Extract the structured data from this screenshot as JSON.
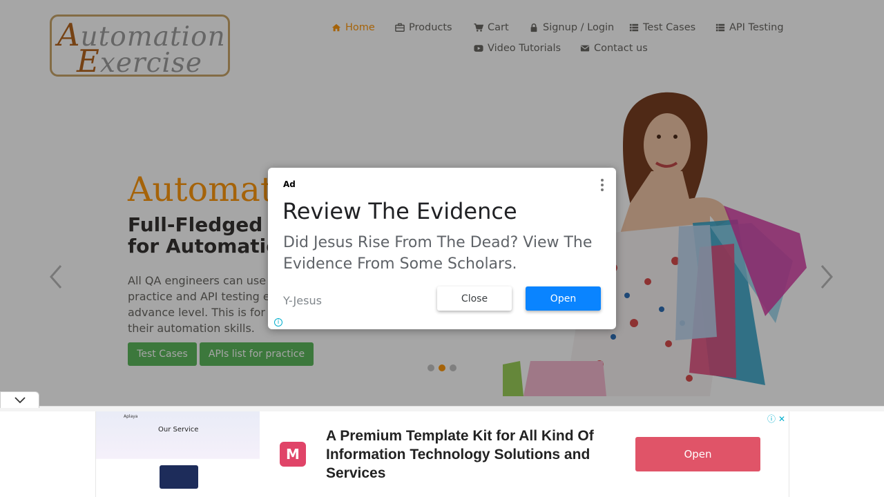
{
  "logo": {
    "line1_cap": "A",
    "line1_rest": "utomation",
    "line2_cap": "E",
    "line2_rest": "xercise"
  },
  "nav": {
    "home": "Home",
    "products": "Products",
    "cart": "Cart",
    "signup": "Signup / Login",
    "test_cases": "Test Cases",
    "api_testing": "API Testing",
    "video": "Video Tutorials",
    "contact": "Contact us"
  },
  "hero": {
    "title": "Automat",
    "subtitle_l1": "Full-Fledged",
    "subtitle_l2": "for Automatic",
    "desc_l1": "All QA engineers can use",
    "desc_l2": "practice and API testing e",
    "desc_l3": "advance level. This is for",
    "desc_l4": "their automation skills.",
    "btn_test_cases": "Test Cases",
    "btn_apis": "APIs list for practice",
    "carousel_active_index": 1,
    "carousel_count": 3
  },
  "modal_ad": {
    "ad_label": "Ad",
    "title": "Review The Evidence",
    "body": "Did Jesus Rise From The Dead? View The Evidence From Some Scholars.",
    "source": "Y-Jesus",
    "close_label": "Close",
    "open_label": "Open",
    "info_icon": "ⓘ"
  },
  "banner_ad": {
    "thumb_header": "Aplaya",
    "thumb_title": "Our Service",
    "logo_letter": "M",
    "text": "A Premium Template Kit for All Kind Of Information Technology Solutions and Services",
    "open_label": "Open",
    "info_icon": "ⓘ",
    "close_icon": "✕"
  },
  "colors": {
    "accent": "#FE980F",
    "green": "#5cb85c",
    "ad_blue": "#0a84ff",
    "banner_red": "#e05468"
  }
}
